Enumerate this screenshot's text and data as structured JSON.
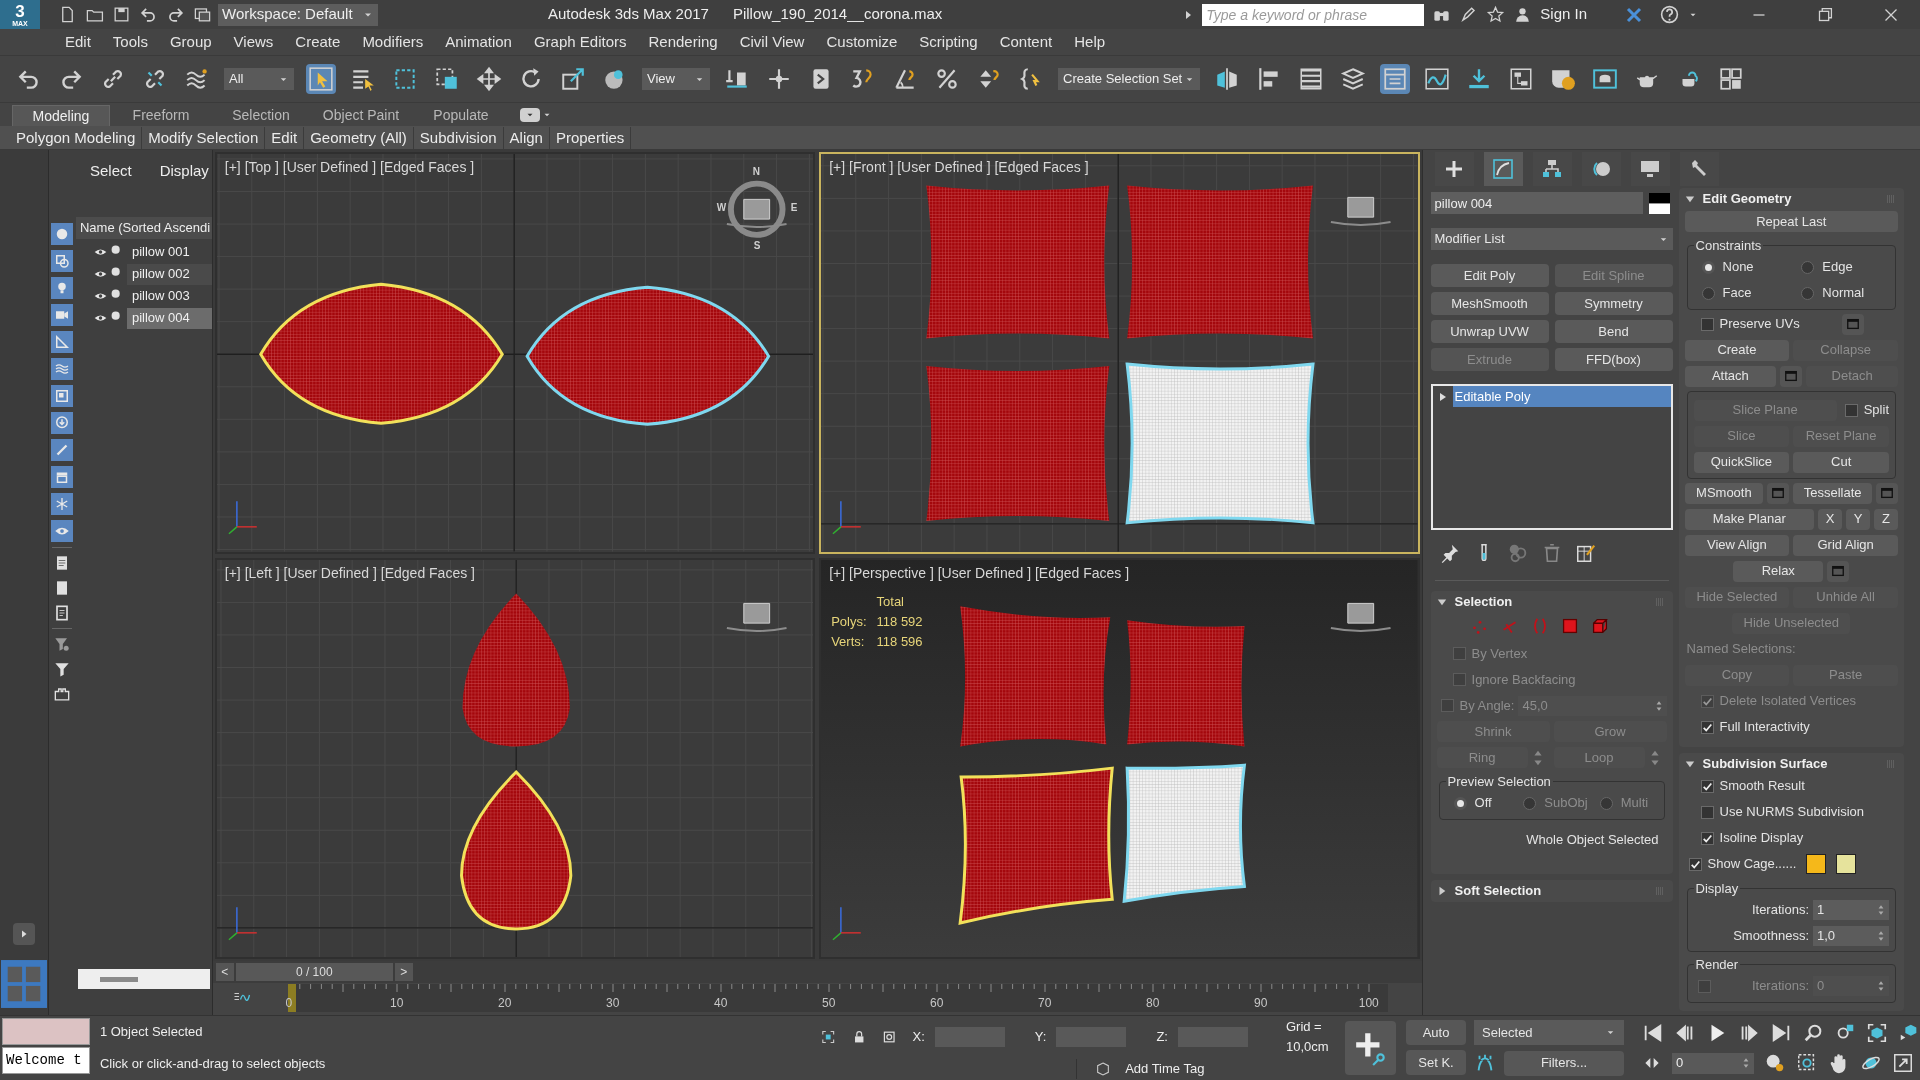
{
  "window": {
    "logo": "3",
    "logo_sub": "MAX",
    "workspace": "Workspace: Default",
    "app": "Autodesk 3ds Max 2017",
    "file": "Pillow_190_2014__corona.max",
    "search": {
      "placeholder": "Type a keyword or phrase"
    },
    "sign_in": "Sign In"
  },
  "menu": [
    "Edit",
    "Tools",
    "Group",
    "Views",
    "Create",
    "Modifiers",
    "Animation",
    "Graph Editors",
    "Rendering",
    "Civil View",
    "Customize",
    "Scripting",
    "Content",
    "Help"
  ],
  "toolbar": {
    "selection_filter": "All",
    "coordinate_system": "View",
    "selection_set": "Create Selection Set"
  },
  "ribbon_tabs": [
    {
      "label": "Modeling",
      "selected": true
    },
    {
      "label": "Freeform",
      "selected": false
    },
    {
      "label": "Selection",
      "selected": false
    },
    {
      "label": "Object Paint",
      "selected": false
    },
    {
      "label": "Populate",
      "selected": false
    }
  ],
  "ribbon_panels": [
    "Polygon Modeling",
    "Modify Selection",
    "Edit",
    "Geometry (All)",
    "Subdivision",
    "Align",
    "Properties"
  ],
  "scene_explorer": {
    "menu": [
      "Select",
      "Display"
    ],
    "column": "Name (Sorted Ascendi",
    "items": [
      {
        "name": "pillow 001",
        "selected": false
      },
      {
        "name": "pillow 002",
        "selected": false
      },
      {
        "name": "pillow 003",
        "selected": false
      },
      {
        "name": "pillow 004",
        "selected": true
      }
    ]
  },
  "viewports": [
    {
      "kind": "top",
      "label": "[+] [Top ] [User Defined ] [Edged Faces ]",
      "active": false,
      "compass": [
        "N",
        "E",
        "S",
        "W"
      ]
    },
    {
      "kind": "front",
      "label": "[+] [Front ] [User Defined ] [Edged Faces ]",
      "active": true
    },
    {
      "kind": "left",
      "label": "[+] [Left ] [User Defined ] [Edged Faces ]",
      "active": false
    },
    {
      "kind": "perspective",
      "label": "[+] [Perspective ] [User Defined ] [Edged Faces ]",
      "active": false,
      "stats": {
        "title": "Total",
        "rows": [
          {
            "label": "Polys:",
            "value": "118 592"
          },
          {
            "label": "Verts:",
            "value": "118 596"
          }
        ]
      }
    }
  ],
  "timeline": {
    "prev": "<",
    "next": ">",
    "frame_label": "0 / 100",
    "level": 0,
    "ticks": [
      "0",
      "10",
      "20",
      "30",
      "40",
      "50",
      "60",
      "70",
      "80",
      "90",
      "100"
    ]
  },
  "command_panel": {
    "panel_tabs": [
      {
        "selected": false
      },
      {
        "selected": true
      },
      {
        "selected": false
      },
      {
        "selected": false
      },
      {
        "selected": false
      },
      {
        "selected": false
      }
    ],
    "object_name": "pillow 004",
    "modifier_list": "Modifier List",
    "modifier_buttons": [
      {
        "label": "Edit Poly",
        "disabled": false
      },
      {
        "label": "Edit Spline",
        "disabled": true
      },
      {
        "label": "MeshSmooth",
        "disabled": false
      },
      {
        "label": "Symmetry",
        "disabled": false
      },
      {
        "label": "Unwrap UVW",
        "disabled": false
      },
      {
        "label": "Bend",
        "disabled": false
      },
      {
        "label": "Extrude",
        "disabled": true
      },
      {
        "label": "FFD(box)",
        "disabled": false
      }
    ],
    "stack": [
      {
        "label": "Editable Poly",
        "selected": true
      }
    ],
    "left_rollouts": [
      {
        "title": "Selection",
        "expanded": true,
        "rows": [
          {
            "kind": "subobject-icons"
          },
          {
            "kind": "row",
            "items": [
              {
                "kind": "checkbox",
                "label": "By Vertex",
                "checked": false,
                "disabled": true
              }
            ]
          },
          {
            "kind": "row",
            "items": [
              {
                "kind": "checkbox",
                "label": "Ignore Backfacing",
                "checked": false,
                "disabled": true
              }
            ]
          },
          {
            "kind": "row",
            "items": [
              {
                "kind": "checkbox",
                "label": "By Angle:",
                "checked": false,
                "disabled": true
              },
              {
                "kind": "spinner",
                "value": "45,0",
                "disabled": true
              }
            ]
          },
          {
            "kind": "row",
            "items": [
              {
                "kind": "button",
                "label": "Shrink",
                "disabled": true
              },
              {
                "kind": "button",
                "label": "Grow",
                "disabled": true
              }
            ]
          },
          {
            "kind": "row",
            "items": [
              {
                "kind": "spin-button",
                "label": "Ring",
                "disabled": true
              },
              {
                "kind": "spin-button",
                "label": "Loop",
                "disabled": true
              }
            ]
          },
          {
            "kind": "group",
            "title": "Preview Selection",
            "rows": [
              {
                "kind": "row",
                "items": [
                  {
                    "kind": "radio",
                    "label": "Off",
                    "selected": true,
                    "disabled": false
                  },
                  {
                    "kind": "radio",
                    "label": "SubObj",
                    "selected": false,
                    "disabled": true
                  },
                  {
                    "kind": "radio",
                    "label": "Multi",
                    "selected": false,
                    "disabled": true
                  }
                ]
              }
            ]
          },
          {
            "kind": "row",
            "items": [
              {
                "kind": "note",
                "label": "Whole Object Selected"
              }
            ]
          }
        ]
      },
      {
        "title": "Soft Selection",
        "expanded": false
      }
    ],
    "right_rollouts": [
      {
        "title": "Edit Geometry",
        "expanded": true,
        "rows": [
          {
            "kind": "row",
            "items": [
              {
                "kind": "button",
                "label": "Repeat Last",
                "disabled": false
              }
            ]
          },
          {
            "kind": "group",
            "title": "Constraints",
            "rows": [
              {
                "kind": "row",
                "items": [
                  {
                    "kind": "radio",
                    "label": "None",
                    "selected": true,
                    "disabled": false
                  },
                  {
                    "kind": "radio",
                    "label": "Edge",
                    "selected": false,
                    "disabled": false
                  }
                ]
              },
              {
                "kind": "row",
                "items": [
                  {
                    "kind": "radio",
                    "label": "Face",
                    "selected": false,
                    "disabled": false
                  },
                  {
                    "kind": "radio",
                    "label": "Normal",
                    "selected": false,
                    "disabled": false
                  }
                ]
              }
            ]
          },
          {
            "kind": "row",
            "items": [
              {
                "kind": "checkbox",
                "label": "Preserve UVs",
                "checked": false,
                "disabled": false,
                "settings": true
              }
            ]
          },
          {
            "kind": "row",
            "items": [
              {
                "kind": "button",
                "label": "Create",
                "disabled": false
              },
              {
                "kind": "button",
                "label": "Collapse",
                "disabled": true
              }
            ]
          },
          {
            "kind": "row",
            "items": [
              {
                "kind": "button",
                "label": "Attach",
                "disabled": false,
                "settings": true
              },
              {
                "kind": "button",
                "label": "Detach",
                "disabled": true
              }
            ]
          },
          {
            "kind": "group",
            "rows": [
              {
                "kind": "row",
                "items": [
                  {
                    "kind": "button",
                    "label": "Slice Plane",
                    "disabled": true
                  },
                  {
                    "kind": "checkbox",
                    "label": "Split",
                    "checked": false,
                    "disabled": false
                  }
                ]
              },
              {
                "kind": "row",
                "items": [
                  {
                    "kind": "button",
                    "label": "Slice",
                    "disabled": true
                  },
                  {
                    "kind": "button",
                    "label": "Reset Plane",
                    "disabled": true
                  }
                ]
              },
              {
                "kind": "row",
                "items": [
                  {
                    "kind": "button",
                    "label": "QuickSlice",
                    "disabled": false
                  },
                  {
                    "kind": "button",
                    "label": "Cut",
                    "disabled": false
                  }
                ]
              }
            ]
          },
          {
            "kind": "row",
            "items": [
              {
                "kind": "button",
                "label": "MSmooth",
                "disabled": false,
                "settings": true
              },
              {
                "kind": "button",
                "label": "Tessellate",
                "disabled": false,
                "settings": true
              }
            ]
          },
          {
            "kind": "row",
            "items": [
              {
                "kind": "button",
                "label": "Make Planar",
                "disabled": false
              },
              {
                "kind": "small-button",
                "label": "X",
                "disabled": false
              },
              {
                "kind": "small-button",
                "label": "Y",
                "disabled": false
              },
              {
                "kind": "small-button",
                "label": "Z",
                "disabled": false
              }
            ]
          },
          {
            "kind": "row",
            "items": [
              {
                "kind": "button",
                "label": "View Align",
                "disabled": false
              },
              {
                "kind": "button",
                "label": "Grid Align",
                "disabled": false
              }
            ]
          },
          {
            "kind": "row",
            "items": [
              {
                "kind": "narrow-button",
                "label": "Relax",
                "disabled": false,
                "settings": true
              }
            ]
          },
          {
            "kind": "row",
            "items": [
              {
                "kind": "button",
                "label": "Hide Selected",
                "disabled": true
              },
              {
                "kind": "button",
                "label": "Unhide All",
                "disabled": true
              }
            ]
          },
          {
            "kind": "row",
            "items": [
              {
                "kind": "narrow-button",
                "label": "Hide Unselected",
                "disabled": true
              }
            ]
          },
          {
            "kind": "row",
            "items": [
              {
                "kind": "text",
                "label": "Named Selections:",
                "disabled": true
              }
            ]
          },
          {
            "kind": "row",
            "items": [
              {
                "kind": "button",
                "label": "Copy",
                "disabled": true
              },
              {
                "kind": "button",
                "label": "Paste",
                "disabled": true
              }
            ]
          },
          {
            "kind": "row",
            "items": [
              {
                "kind": "checkbox",
                "label": "Delete Isolated Vertices",
                "checked": true,
                "disabled": true
              }
            ]
          },
          {
            "kind": "row",
            "items": [
              {
                "kind": "checkbox",
                "label": "Full Interactivity",
                "checked": true,
                "disabled": false
              }
            ]
          }
        ]
      },
      {
        "title": "Subdivision Surface",
        "expanded": true,
        "rows": [
          {
            "kind": "row",
            "items": [
              {
                "kind": "checkbox",
                "label": "Smooth Result",
                "checked": true,
                "disabled": false
              }
            ]
          },
          {
            "kind": "row",
            "items": [
              {
                "kind": "checkbox",
                "label": "Use NURMS Subdivision",
                "checked": false,
                "disabled": false
              }
            ]
          },
          {
            "kind": "row",
            "items": [
              {
                "kind": "checkbox",
                "label": "Isoline Display",
                "checked": true,
                "disabled": false
              }
            ]
          },
          {
            "kind": "row",
            "items": [
              {
                "kind": "checkbox",
                "label": "Show Cage......",
                "checked": true,
                "disabled": false
              },
              {
                "kind": "swatch",
                "color": "#f5b81a"
              },
              {
                "kind": "swatch",
                "color": "#e6e39c"
              }
            ]
          },
          {
            "kind": "group",
            "title": "Display",
            "rows": [
              {
                "kind": "row",
                "items": [
                  {
                    "kind": "spinner",
                    "label": "Iterations:",
                    "value": "1",
                    "disabled": false
                  }
                ]
              },
              {
                "kind": "row",
                "items": [
                  {
                    "kind": "spinner",
                    "label": "Smoothness:",
                    "value": "1,0",
                    "disabled": false
                  }
                ]
              }
            ]
          },
          {
            "kind": "group",
            "title": "Render",
            "rows": [
              {
                "kind": "row",
                "items": [
                  {
                    "kind": "checkbox",
                    "checked": false,
                    "disabled": true
                  },
                  {
                    "kind": "spinner",
                    "label": "Iterations:",
                    "value": "0",
                    "disabled": true
                  }
                ]
              }
            ]
          }
        ]
      }
    ]
  },
  "status": {
    "listener": "Welcome t",
    "selection": "1 Object Selected",
    "prompt": "Click or click-and-drag to select objects",
    "coords": [
      "X:",
      "Y:",
      "Z:"
    ],
    "grid": "Grid = 10,0cm",
    "time_tag": "Add Time Tag"
  },
  "animation": {
    "auto": "Auto",
    "key_mode": "Selected",
    "set_key": "Set K.",
    "filters": "Filters...",
    "frame": "0"
  }
}
